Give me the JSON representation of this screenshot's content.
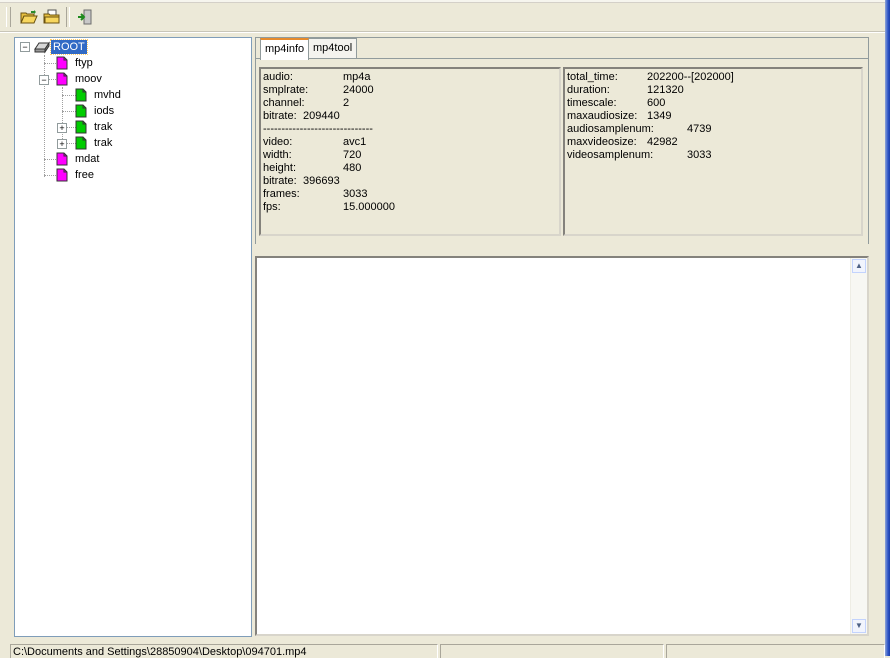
{
  "toolbar": {
    "buttons": [
      {
        "icon": "open-folder-icon"
      },
      {
        "icon": "batch-open-icon"
      },
      {
        "icon": "exit-icon"
      }
    ]
  },
  "tree": {
    "root": "ROOT",
    "nodes": [
      "ftyp",
      "moov",
      "mvhd",
      "iods",
      "trak",
      "trak",
      "mdat",
      "free"
    ],
    "colors": {
      "container": "#ff00ff",
      "leaf": "#00cc00"
    }
  },
  "tabs": [
    "mp4info",
    "mp4tool"
  ],
  "info_left": [
    {
      "k": "audio:",
      "v": "mp4a"
    },
    {
      "k": "smplrate:",
      "v": "24000"
    },
    {
      "k": "channel:",
      "v": "2"
    },
    {
      "k": "bitrate:",
      "v": "209440"
    },
    {
      "k": "------------------------------",
      "v": ""
    },
    {
      "k": "video:",
      "v": "avc1"
    },
    {
      "k": "width:",
      "v": "720"
    },
    {
      "k": "height:",
      "v": "480"
    },
    {
      "k": "bitrate:",
      "v": "396693"
    },
    {
      "k": "frames:",
      "v": "3033"
    },
    {
      "k": "fps:",
      "v": "15.000000"
    }
  ],
  "info_right": [
    {
      "k": "total_time:",
      "v": "202200--[202000]"
    },
    {
      "k": "duration:",
      "v": "121320"
    },
    {
      "k": "timescale:",
      "v": "600"
    },
    {
      "k": "maxaudiosize:",
      "v": "1349"
    },
    {
      "k": "audiosamplenum:",
      "v": "4739"
    },
    {
      "k": "maxvideosize:",
      "v": "42982"
    },
    {
      "k": "videosamplenum:",
      "v": "3033"
    }
  ],
  "status": {
    "path": "C:\\Documents and Settings\\28850904\\Desktop\\094701.mp4",
    "panel2": "",
    "panel3": ""
  }
}
